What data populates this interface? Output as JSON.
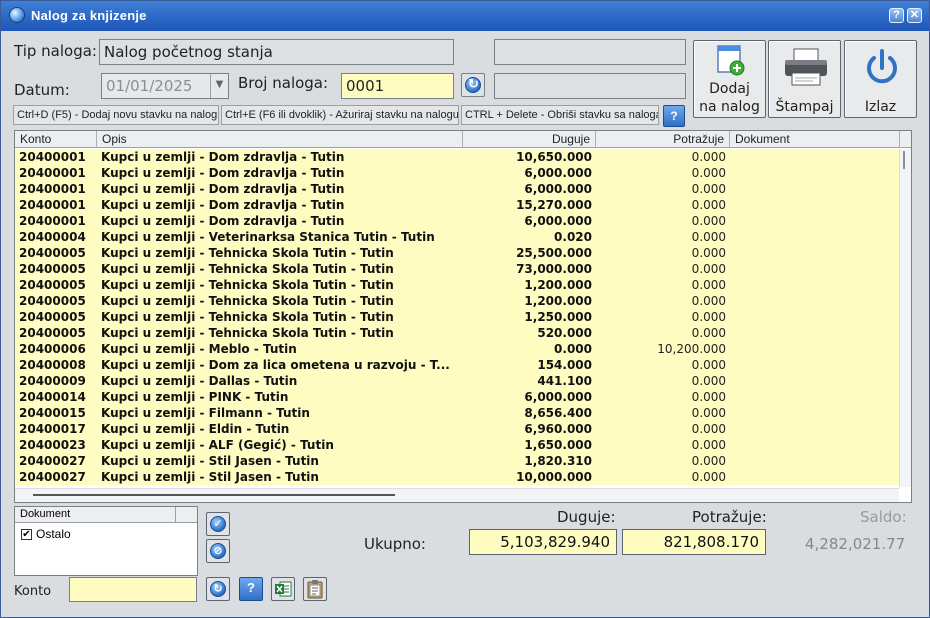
{
  "window": {
    "title": "Nalog za knjizenje",
    "help_glyph": "?",
    "close_glyph": "✕"
  },
  "form": {
    "tip_label": "Tip naloga:",
    "tip_value": "Nalog početnog stanja",
    "datum_label": "Datum:",
    "datum_value": "01/01/2025",
    "broj_label": "Broj naloga:",
    "broj_value": "0001"
  },
  "buttons": {
    "dodaj_line1": "Dodaj",
    "dodaj_line2": "na nalog",
    "stampaj": "Štampaj",
    "izlaz": "Izlaz"
  },
  "shortcuts": [
    "Ctrl+D (F5) - Dodaj novu stavku na nalog",
    "Ctrl+E (F6 ili dvoklik) - Ažuriraj stavku na nalogu",
    "CTRL + Delete - Obriši stavku sa naloga"
  ],
  "shortcut_help": "?",
  "table": {
    "headers": [
      "Konto",
      "Opis",
      "Duguje",
      "Potražuje",
      "Dokument"
    ],
    "rows": [
      [
        "20400001",
        "Kupci u zemlji - Dom zdravlja - Tutin",
        "10,650.000",
        "0.000",
        ""
      ],
      [
        "20400001",
        "Kupci u zemlji - Dom zdravlja - Tutin",
        "6,000.000",
        "0.000",
        ""
      ],
      [
        "20400001",
        "Kupci u zemlji - Dom zdravlja - Tutin",
        "6,000.000",
        "0.000",
        ""
      ],
      [
        "20400001",
        "Kupci u zemlji - Dom zdravlja - Tutin",
        "15,270.000",
        "0.000",
        ""
      ],
      [
        "20400001",
        "Kupci u zemlji - Dom zdravlja - Tutin",
        "6,000.000",
        "0.000",
        ""
      ],
      [
        "20400004",
        "Kupci u zemlji - Veterinarksa Stanica Tutin - Tutin",
        "0.020",
        "0.000",
        ""
      ],
      [
        "20400005",
        "Kupci u zemlji - Tehnicka Skola Tutin - Tutin",
        "25,500.000",
        "0.000",
        ""
      ],
      [
        "20400005",
        "Kupci u zemlji - Tehnicka Skola Tutin - Tutin",
        "73,000.000",
        "0.000",
        ""
      ],
      [
        "20400005",
        "Kupci u zemlji - Tehnicka Skola Tutin - Tutin",
        "1,200.000",
        "0.000",
        ""
      ],
      [
        "20400005",
        "Kupci u zemlji - Tehnicka Skola Tutin - Tutin",
        "1,200.000",
        "0.000",
        ""
      ],
      [
        "20400005",
        "Kupci u zemlji - Tehnicka Skola Tutin - Tutin",
        "1,250.000",
        "0.000",
        ""
      ],
      [
        "20400005",
        "Kupci u zemlji - Tehnicka Skola Tutin - Tutin",
        "520.000",
        "0.000",
        ""
      ],
      [
        "20400006",
        "Kupci u zemlji - Meblo - Tutin",
        "0.000",
        "10,200.000",
        ""
      ],
      [
        "20400008",
        "Kupci u zemlji - Dom za lica ometena u razvoju - T...",
        "154.000",
        "0.000",
        ""
      ],
      [
        "20400009",
        "Kupci u zemlji - Dallas - Tutin",
        "441.100",
        "0.000",
        ""
      ],
      [
        "20400014",
        "Kupci u zemlji - PINK - Tutin",
        "6,000.000",
        "0.000",
        ""
      ],
      [
        "20400015",
        "Kupci u zemlji - Filmann - Tutin",
        "8,656.400",
        "0.000",
        ""
      ],
      [
        "20400017",
        "Kupci u zemlji - Eldin - Tutin",
        "6,960.000",
        "0.000",
        ""
      ],
      [
        "20400023",
        "Kupci u zemlji - ALF (Gegić) - Tutin",
        "1,650.000",
        "0.000",
        ""
      ],
      [
        "20400027",
        "Kupci u zemlji - Stil Jasen - Tutin",
        "1,820.310",
        "0.000",
        ""
      ],
      [
        "20400027",
        "Kupci u zemlji - Stil Jasen - Tutin",
        "10,000.000",
        "0.000",
        ""
      ]
    ]
  },
  "doc_filter": {
    "header": "Dokument",
    "item": "Ostalo",
    "check": "✔"
  },
  "totals": {
    "duguje_label": "Duguje:",
    "potrazuje_label": "Potražuje:",
    "saldo_label": "Saldo:",
    "ukupno_label": "Ukupno:",
    "duguje_value": "5,103,829.940",
    "potrazuje_value": "821,808.170",
    "saldo_value": "4,282,021.77"
  },
  "konto_label": "Konto",
  "konto_value": "",
  "icons": {
    "confirm": "checkmark-icon",
    "cancel": "cancel-icon",
    "refresh": "refresh-icon",
    "help": "help-icon",
    "excel": "excel-icon",
    "clipboard": "clipboard-icon"
  }
}
